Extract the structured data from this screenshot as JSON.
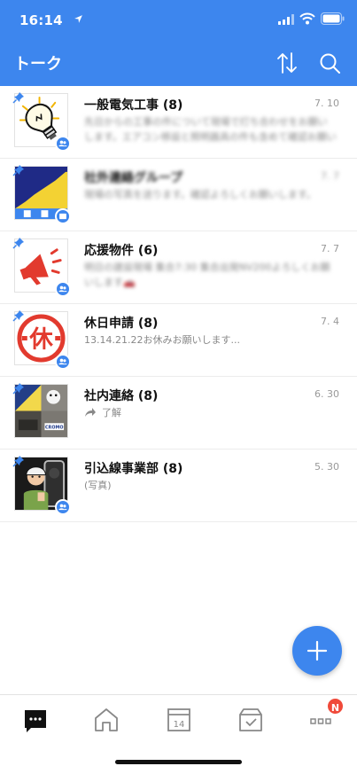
{
  "status_bar": {
    "time": "16:14"
  },
  "header": {
    "title": "トーク"
  },
  "chats": [
    {
      "title": "一般電気工事",
      "count": "(8)",
      "date": "7. 10",
      "preview": "先日からの工事の件について現場で打ち合わせをお願いします。エアコン移設と照明器具の件も含めて確認お願いします。"
    },
    {
      "title": "社外連絡グループ",
      "count": "",
      "date": "7. 7",
      "preview": "現場の写真を送ります。確認よろしくお願いします。"
    },
    {
      "title": "応援物件",
      "count": "(6)",
      "date": "7. 7",
      "preview": "明日の建設現場 集合7:30 集合出発NV200よろしくお願いします🚗"
    },
    {
      "title": "休日申請",
      "count": "(8)",
      "date": "7. 4",
      "preview": "13.14.21.22お休みお願いします..."
    },
    {
      "title": "社内連絡",
      "count": "(8)",
      "date": "6. 30",
      "preview": "了解"
    },
    {
      "title": "引込線事業部",
      "count": "(8)",
      "date": "5. 30",
      "preview": "(写真)"
    }
  ],
  "avatar_labels": {
    "holiday": "休",
    "cromo": "CROMO"
  },
  "tab_badge": "N",
  "calendar_day": "14",
  "colors": {
    "brand_blue": "#3d86ee",
    "badge_red": "#f04a3a"
  }
}
